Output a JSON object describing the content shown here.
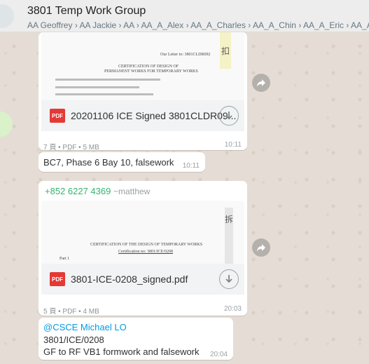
{
  "header": {
    "title": "3801 Temp Work Group",
    "members": "AA Geoffrey › AA Jackie › AA › AA_A_Alex › AA_A_Charles › AA_A_Chin › AA_A_Eric › AA_A_Eric"
  },
  "messages": {
    "doc1": {
      "preview_ref": "Our Letter to: 3801CLDR092",
      "preview_heading1": "CERTIFICATION OF DESIGN OF",
      "preview_heading2": "PERMANENT WORKS FOR TEMPORARY WORKS",
      "preview_stamp": "扣",
      "filename": "20201106 ICE Signed 3801CLDR09...",
      "meta": "7 頁 • PDF • 5 MB",
      "time": "10:11"
    },
    "text1": {
      "text": "BC7, Phase 6 Bay 10, falsework",
      "time": "10:11"
    },
    "doc2": {
      "sender_phone": "+852 6227 4369",
      "sender_nick": "~matthew",
      "preview_heading1": "CERTIFICATION OF THE DESIGN OF TEMPORARY WORKS",
      "preview_heading2": "Certification no: 3801/ICE/0208",
      "preview_part": "Part 1",
      "preview_stamp": "拆",
      "filename": "3801-ICE-0208_signed.pdf",
      "meta": "5 頁 • PDF • 4 MB",
      "time": "20:03"
    },
    "text2": {
      "mention": "@CSCE Michael LO",
      "line2": "3801/ICE/0208",
      "line3": "GF to RF VB1 formwork and falsework",
      "time": "20:04"
    }
  },
  "icons": {
    "pdf_badge": "PDF",
    "download": "download-icon",
    "forward": "forward-icon"
  },
  "colors": {
    "chat_bg": "#e5ddd5",
    "sender": "#35b46e",
    "mention": "#039be5",
    "pdf": "#e53935"
  }
}
